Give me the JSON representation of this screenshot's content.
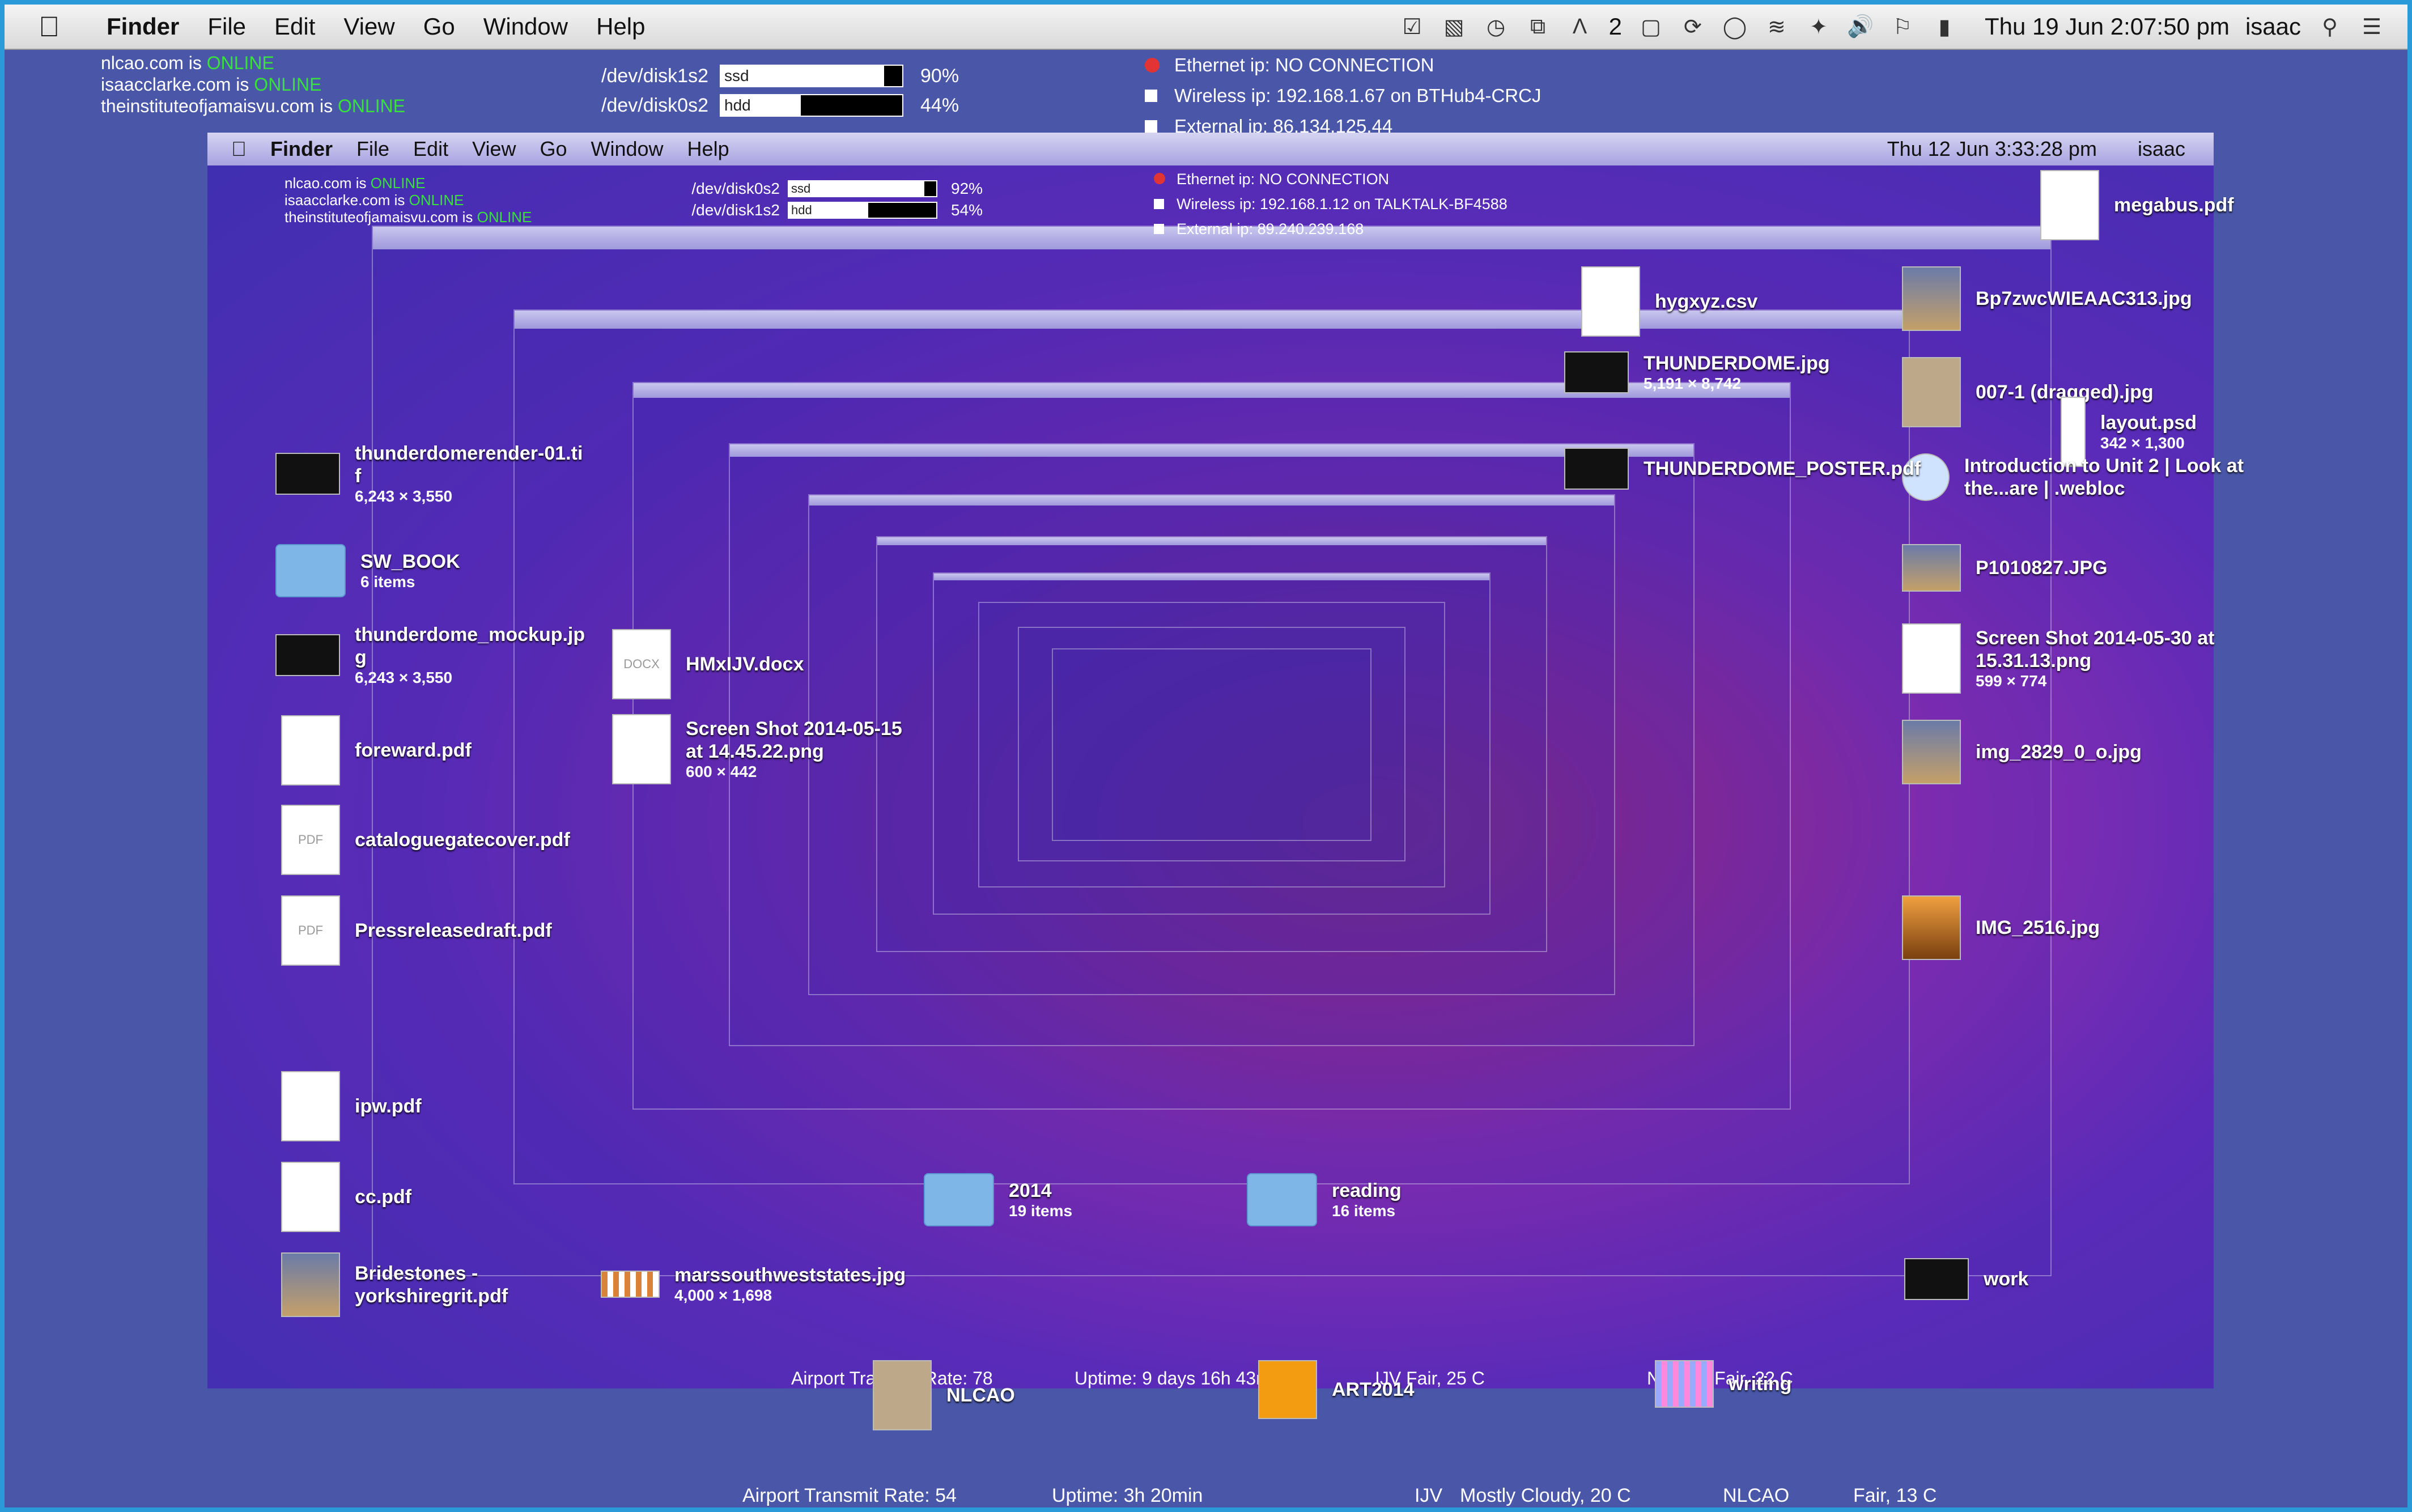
{
  "menubar": {
    "app": "Finder",
    "menus": [
      "File",
      "Edit",
      "View",
      "Go",
      "Window",
      "Help"
    ],
    "status_text": "2",
    "clock": "Thu 19 Jun  2:07:50 pm",
    "user": "isaac"
  },
  "domains": [
    {
      "host": "nlcao.com is",
      "status": "ONLINE"
    },
    {
      "host": "isaacclarke.com is",
      "status": "ONLINE"
    },
    {
      "host": "theinstituteofjamaisvu.com is",
      "status": "ONLINE"
    }
  ],
  "disks": [
    {
      "name": "/dev/disk1s2",
      "label": "ssd",
      "percent_text": "90%",
      "fill": 0.9
    },
    {
      "name": "/dev/disk0s2",
      "label": "hdd",
      "percent_text": "44%",
      "fill": 0.44
    }
  ],
  "network": {
    "ethernet": "Ethernet ip: NO CONNECTION",
    "wireless": "Wireless ip: 192.168.1.67 on BTHub4-CRCJ",
    "external": "External ip: 86.134.125.44"
  },
  "inner_menubar": {
    "app": "Finder",
    "menus": [
      "File",
      "Edit",
      "View",
      "Go",
      "Window",
      "Help"
    ],
    "clock": "Thu 12 Jun  3:33:28 pm",
    "user": "isaac"
  },
  "inner_domains": [
    {
      "host": "nlcao.com is",
      "status": "ONLINE"
    },
    {
      "host": "isaacclarke.com is",
      "status": "ONLINE"
    },
    {
      "host": "theinstituteofjamaisvu.com is",
      "status": "ONLINE"
    }
  ],
  "inner_disks": [
    {
      "name": "/dev/disk0s2",
      "label": "ssd",
      "percent_text": "92%",
      "fill": 0.92
    },
    {
      "name": "/dev/disk1s2",
      "label": "hdd",
      "percent_text": "54%",
      "fill": 0.54
    }
  ],
  "inner_network": {
    "ethernet": "Ethernet ip: NO CONNECTION",
    "wireless": "Wireless ip: 192.168.1.12 on TALKTALK-BF4588",
    "external": "External ip: 89.240.239.168"
  },
  "left_icons": [
    {
      "name": "thunderdomerender-01.ti f",
      "sub": "6,243 × 3,550"
    },
    {
      "name": "SW_BOOK",
      "sub": "6 items"
    },
    {
      "name": "thunderdome_mockup.jp g",
      "sub": "6,243 × 3,550"
    },
    {
      "name": "foreward.pdf",
      "sub": ""
    },
    {
      "name": "cataloguegatecover.pdf",
      "sub": ""
    },
    {
      "name": "Pressreleasedraft.pdf",
      "sub": ""
    },
    {
      "name": "ipw.pdf",
      "sub": ""
    },
    {
      "name": "cc.pdf",
      "sub": ""
    },
    {
      "name": "Bridestones - yorkshiregrit.pdf",
      "sub": ""
    }
  ],
  "right_icons": [
    {
      "name": "megabus.pdf",
      "sub": ""
    },
    {
      "name": "hygxyz.csv",
      "sub": ""
    },
    {
      "name": "Bp7zwcWIEAAC313.jpg",
      "sub": ""
    },
    {
      "name": "007-1 (dragged).jpg",
      "sub": ""
    },
    {
      "name": "layout.psd",
      "sub": "342 × 1,300"
    },
    {
      "name": "Introduction to Unit 2 | Look at the...are | .webloc",
      "sub": ""
    },
    {
      "name": "P1010827.JPG",
      "sub": ""
    },
    {
      "name": "Screen Shot 2014-05-30 at 15.31.13.png",
      "sub": "599 × 774"
    },
    {
      "name": "img_2829_0_o.jpg",
      "sub": ""
    },
    {
      "name": "IMG_2516.jpg",
      "sub": ""
    }
  ],
  "center_icons": [
    {
      "name": "THUNDERDOME.jpg",
      "sub": "5,191 × 8,742"
    },
    {
      "name": "THUNDERDOME_POSTER.pdf",
      "sub": ""
    },
    {
      "name": "HMxIJV.docx",
      "sub": ""
    },
    {
      "name": "Screen Shot 2014-05-15 at 14.45.22.png",
      "sub": "600 × 442"
    },
    {
      "name": "marssouthweststates.jpg",
      "sub": "4,000 × 1,698"
    },
    {
      "name": "NLCAO",
      "sub": ""
    },
    {
      "name": "ART2014",
      "sub": ""
    },
    {
      "name": "writing",
      "sub": ""
    },
    {
      "name": "work",
      "sub": ""
    },
    {
      "name": "2014",
      "sub": "19 items"
    },
    {
      "name": "reading",
      "sub": "16 items"
    }
  ],
  "inner_stats": {
    "airport": "Airport Transmit Rate: 78",
    "uptime": "Uptime: 9 days 16h 43m",
    "weather1": "IJV  Fair, 25 C",
    "weather2": "NLCAO  Fair, 22 C"
  },
  "bottom_status": {
    "airport": "Airport Transmit Rate: 54",
    "uptime": "Uptime: 3h 20min",
    "weather1_place": "IJV",
    "weather1": "Mostly Cloudy, 20 C",
    "weather2_place": "NLCAO",
    "weather2": "Fair, 13 C"
  }
}
